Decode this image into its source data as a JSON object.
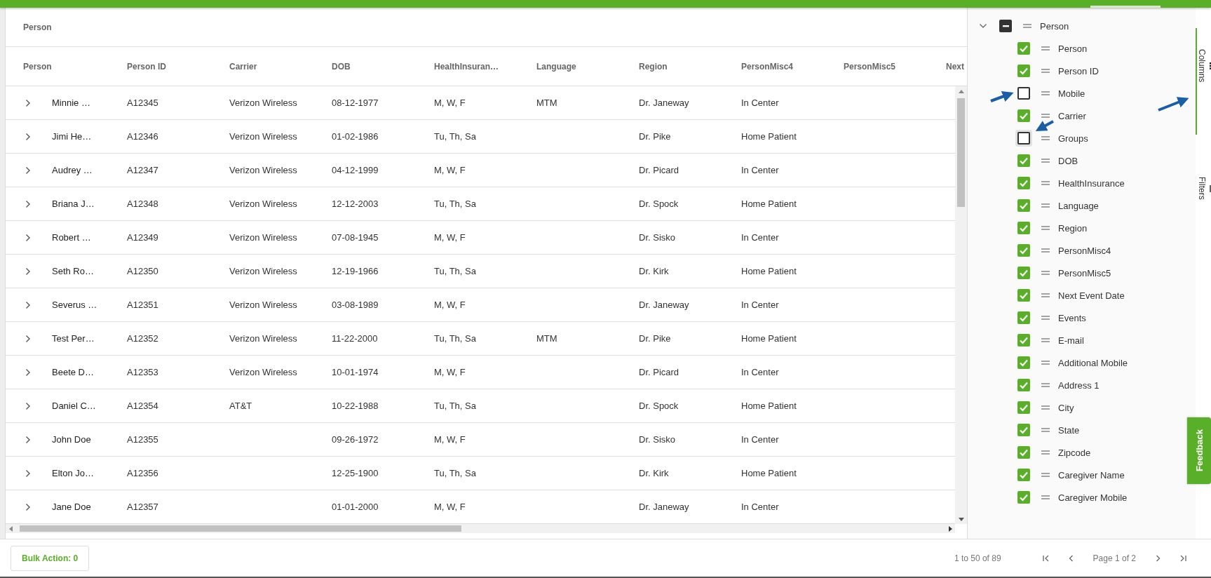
{
  "grid": {
    "title": "Person",
    "columns": [
      "Person",
      "Person ID",
      "Carrier",
      "DOB",
      "HealthInsuran…",
      "Language",
      "Region",
      "PersonMisc4",
      "PersonMisc5",
      "Next"
    ],
    "rows": [
      {
        "person": "Minnie …",
        "person_id": "A12345",
        "carrier": "Verizon Wireless",
        "dob": "08-12-1977",
        "health_insurance": "M, W, F",
        "language": "MTM",
        "region": "Dr. Janeway",
        "person_misc4": "In Center"
      },
      {
        "person": "Jimi He…",
        "person_id": "A12346",
        "carrier": "Verizon Wireless",
        "dob": "01-02-1986",
        "health_insurance": "Tu, Th, Sa",
        "region": "Dr. Pike",
        "person_misc4": "Home Patient"
      },
      {
        "person": "Audrey …",
        "person_id": "A12347",
        "carrier": "Verizon Wireless",
        "dob": "04-12-1999",
        "health_insurance": "M, W, F",
        "region": "Dr. Picard",
        "person_misc4": "In Center"
      },
      {
        "person": "Briana J…",
        "person_id": "A12348",
        "carrier": "Verizon Wireless",
        "dob": "12-12-2003",
        "health_insurance": "Tu, Th, Sa",
        "region": "Dr. Spock",
        "person_misc4": "Home Patient"
      },
      {
        "person": "Robert …",
        "person_id": "A12349",
        "carrier": "Verizon Wireless",
        "dob": "07-08-1945",
        "health_insurance": "M, W, F",
        "region": "Dr. Sisko",
        "person_misc4": "In Center"
      },
      {
        "person": "Seth Ro…",
        "person_id": "A12350",
        "carrier": "Verizon Wireless",
        "dob": "12-19-1966",
        "health_insurance": "Tu, Th, Sa",
        "region": "Dr. Kirk",
        "person_misc4": "Home Patient"
      },
      {
        "person": "Severus …",
        "person_id": "A12351",
        "carrier": "Verizon Wireless",
        "dob": "03-08-1989",
        "health_insurance": "M, W, F",
        "region": "Dr. Janeway",
        "person_misc4": "In Center"
      },
      {
        "person": "Test Per…",
        "person_id": "A12352",
        "carrier": "Verizon Wireless",
        "dob": "11-22-2000",
        "health_insurance": "Tu, Th, Sa",
        "language": "MTM",
        "region": "Dr. Pike",
        "person_misc4": "Home Patient"
      },
      {
        "person": "Beete D…",
        "person_id": "A12353",
        "carrier": "Verizon Wireless",
        "dob": "10-01-1974",
        "health_insurance": "M, W, F",
        "region": "Dr. Picard",
        "person_misc4": "In Center"
      },
      {
        "person": "Daniel C…",
        "person_id": "A12354",
        "carrier": "AT&T",
        "dob": "10-22-1988",
        "health_insurance": "Tu, Th, Sa",
        "region": "Dr. Spock",
        "person_misc4": "Home Patient"
      },
      {
        "person": "John Doe",
        "person_id": "A12355",
        "dob": "09-26-1972",
        "health_insurance": "M, W, F",
        "region": "Dr. Sisko",
        "person_misc4": "In Center"
      },
      {
        "person": "Elton Jo…",
        "person_id": "A12356",
        "dob": "12-25-1900",
        "health_insurance": "Tu, Th, Sa",
        "region": "Dr. Kirk",
        "person_misc4": "Home Patient"
      },
      {
        "person": "Jane Doe",
        "person_id": "A12357",
        "dob": "01-01-2000",
        "health_insurance": "M, W, F",
        "region": "Dr. Janeway",
        "person_misc4": "In Center"
      }
    ]
  },
  "column_panel": {
    "group": {
      "label": "Person",
      "expanded": true,
      "indeterminate": true
    },
    "items": [
      {
        "label": "Person",
        "checked": true
      },
      {
        "label": "Person ID",
        "checked": true
      },
      {
        "label": "Mobile",
        "checked": false
      },
      {
        "label": "Carrier",
        "checked": true
      },
      {
        "label": "Groups",
        "checked": false,
        "focused": true
      },
      {
        "label": "DOB",
        "checked": true
      },
      {
        "label": "HealthInsurance",
        "checked": true
      },
      {
        "label": "Language",
        "checked": true
      },
      {
        "label": "Region",
        "checked": true
      },
      {
        "label": "PersonMisc4",
        "checked": true
      },
      {
        "label": "PersonMisc5",
        "checked": true
      },
      {
        "label": "Next Event Date",
        "checked": true
      },
      {
        "label": "Events",
        "checked": true
      },
      {
        "label": "E-mail",
        "checked": true
      },
      {
        "label": "Additional Mobile",
        "checked": true
      },
      {
        "label": "Address 1",
        "checked": true
      },
      {
        "label": "City",
        "checked": true
      },
      {
        "label": "State",
        "checked": true
      },
      {
        "label": "Zipcode",
        "checked": true
      },
      {
        "label": "Caregiver Name",
        "checked": true
      },
      {
        "label": "Caregiver Mobile",
        "checked": true
      }
    ]
  },
  "side_tabs": [
    {
      "label": "Columns",
      "kind": "columns",
      "selected": true
    },
    {
      "label": "Filters",
      "kind": "filters",
      "selected": false
    }
  ],
  "feedback": {
    "label": "Feedback"
  },
  "footer": {
    "bulk_action": "Bulk Action: 0",
    "range": "1 to 50 of 89",
    "page": "Page 1 of 2"
  }
}
